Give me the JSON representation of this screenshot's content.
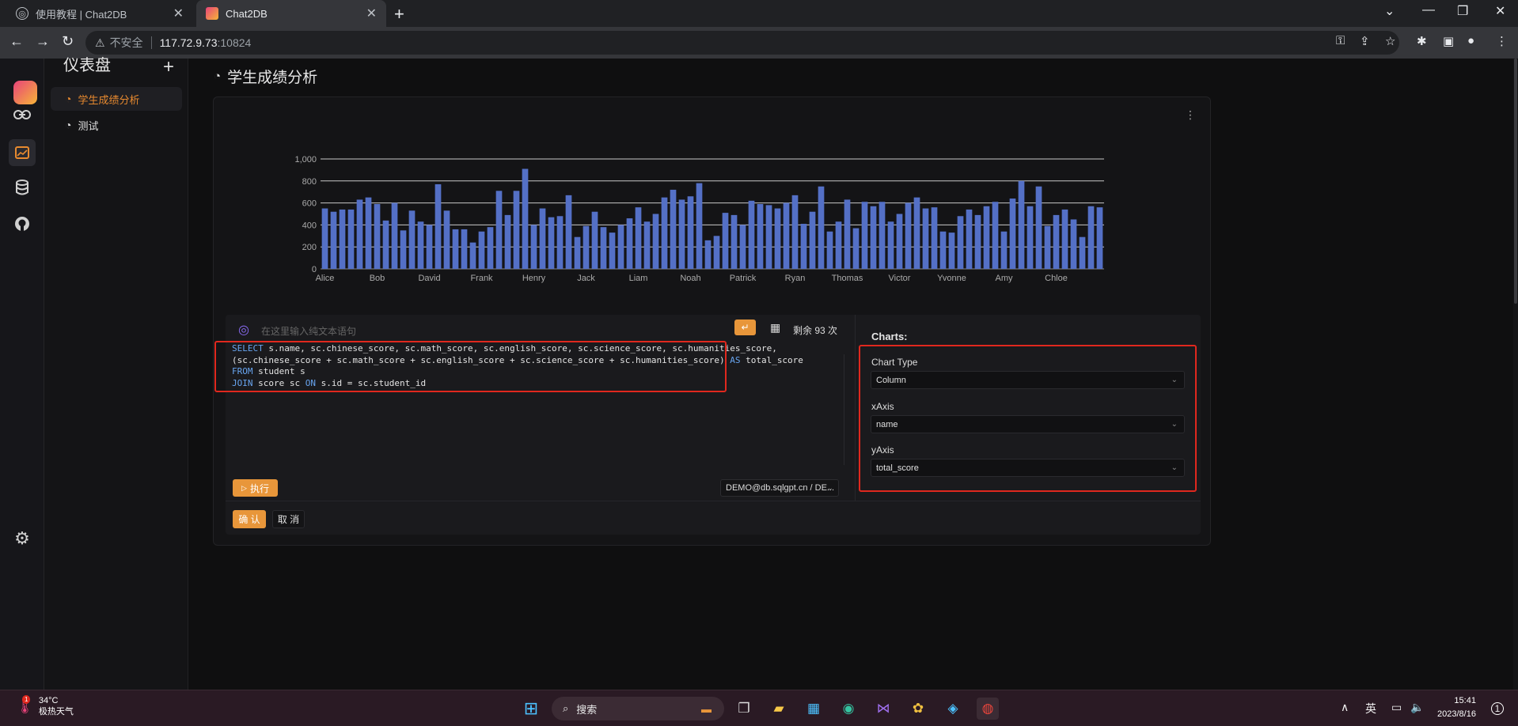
{
  "browser": {
    "tabs": [
      {
        "title": "使用教程 | Chat2DB",
        "active": false
      },
      {
        "title": "Chat2DB",
        "active": true
      }
    ],
    "omnibox": {
      "security": "不安全",
      "host": "117.72.9.73",
      "port": ":10824"
    }
  },
  "sidebar": {
    "title": "仪表盘",
    "items": [
      {
        "label": "学生成绩分析",
        "active": true
      },
      {
        "label": "测试",
        "active": false
      }
    ]
  },
  "main": {
    "title": "学生成绩分析",
    "ai_placeholder": "在这里输入纯文本语句",
    "remaining": "剩余 93 次",
    "sql_lines": [
      "SELECT s.name, sc.chinese_score, sc.math_score, sc.english_score, sc.science_score, sc.humanities_score,",
      "(sc.chinese_score + sc.math_score + sc.english_score + sc.science_score + sc.humanities_score) AS total_score",
      "FROM student s",
      "JOIN score sc ON s.id = sc.student_id"
    ],
    "run_label": "执行",
    "datasource": "DEMO@db.sqlgpt.cn / DE...",
    "confirm_label": "确 认",
    "cancel_label": "取 消"
  },
  "config": {
    "heading": "Charts:",
    "chart_type_label": "Chart Type",
    "chart_type": "Column",
    "xaxis_label": "xAxis",
    "xaxis": "name",
    "yaxis_label": "yAxis",
    "yaxis": "total_score"
  },
  "chart_data": {
    "type": "bar",
    "x_field": "name",
    "y_field": "total_score",
    "ylim": [
      0,
      1000
    ],
    "yticks": [
      "0",
      "200",
      "400",
      "600",
      "800",
      "1,000"
    ],
    "grid": true,
    "bar_color": "#5470c6",
    "tick_labels": [
      "Alice",
      "Bob",
      "David",
      "Frank",
      "Henry",
      "Jack",
      "Liam",
      "Noah",
      "Patrick",
      "Ryan",
      "Thomas",
      "Victor",
      "Yvonne",
      "Amy",
      "Chloe"
    ],
    "values": [
      550,
      520,
      540,
      540,
      630,
      650,
      590,
      440,
      600,
      350,
      530,
      430,
      400,
      770,
      530,
      360,
      360,
      240,
      340,
      380,
      710,
      490,
      710,
      910,
      400,
      550,
      470,
      480,
      670,
      290,
      390,
      520,
      380,
      330,
      400,
      460,
      560,
      430,
      500,
      650,
      720,
      630,
      660,
      780,
      260,
      300,
      510,
      490,
      400,
      620,
      590,
      580,
      550,
      600,
      670,
      410,
      520,
      750,
      340,
      430,
      630,
      370,
      610,
      570,
      610,
      430,
      500,
      600,
      650,
      550,
      560,
      340,
      330,
      480,
      540,
      490,
      570,
      610,
      340,
      640,
      800,
      570,
      750,
      390,
      490,
      540,
      450,
      290,
      570,
      560
    ]
  },
  "taskbar": {
    "temp": "34°C",
    "weather": "极热天气",
    "badge": "1",
    "search": "搜索",
    "ime": "英",
    "time": "15:41",
    "date": "2023/8/16"
  }
}
